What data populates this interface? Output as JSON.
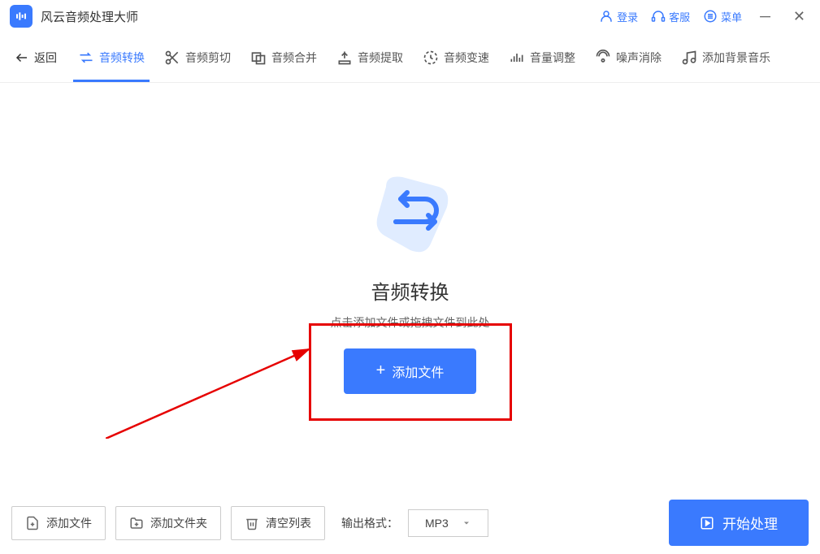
{
  "app": {
    "title": "风云音频处理大师"
  },
  "titlebar": {
    "login": "登录",
    "service": "客服",
    "menu": "菜单"
  },
  "toolbar": {
    "back": "返回",
    "items": [
      {
        "label": "音频转换"
      },
      {
        "label": "音频剪切"
      },
      {
        "label": "音频合并"
      },
      {
        "label": "音频提取"
      },
      {
        "label": "音频变速"
      },
      {
        "label": "音量调整"
      },
      {
        "label": "噪声消除"
      },
      {
        "label": "添加背景音乐"
      }
    ]
  },
  "main": {
    "title": "音频转换",
    "hint": "点击添加文件或拖拽文件到此处",
    "add_button": "添加文件"
  },
  "bottom": {
    "add_file": "添加文件",
    "add_folder": "添加文件夹",
    "clear": "清空列表",
    "format_label": "输出格式：",
    "format_value": "MP3",
    "start": "开始处理"
  }
}
